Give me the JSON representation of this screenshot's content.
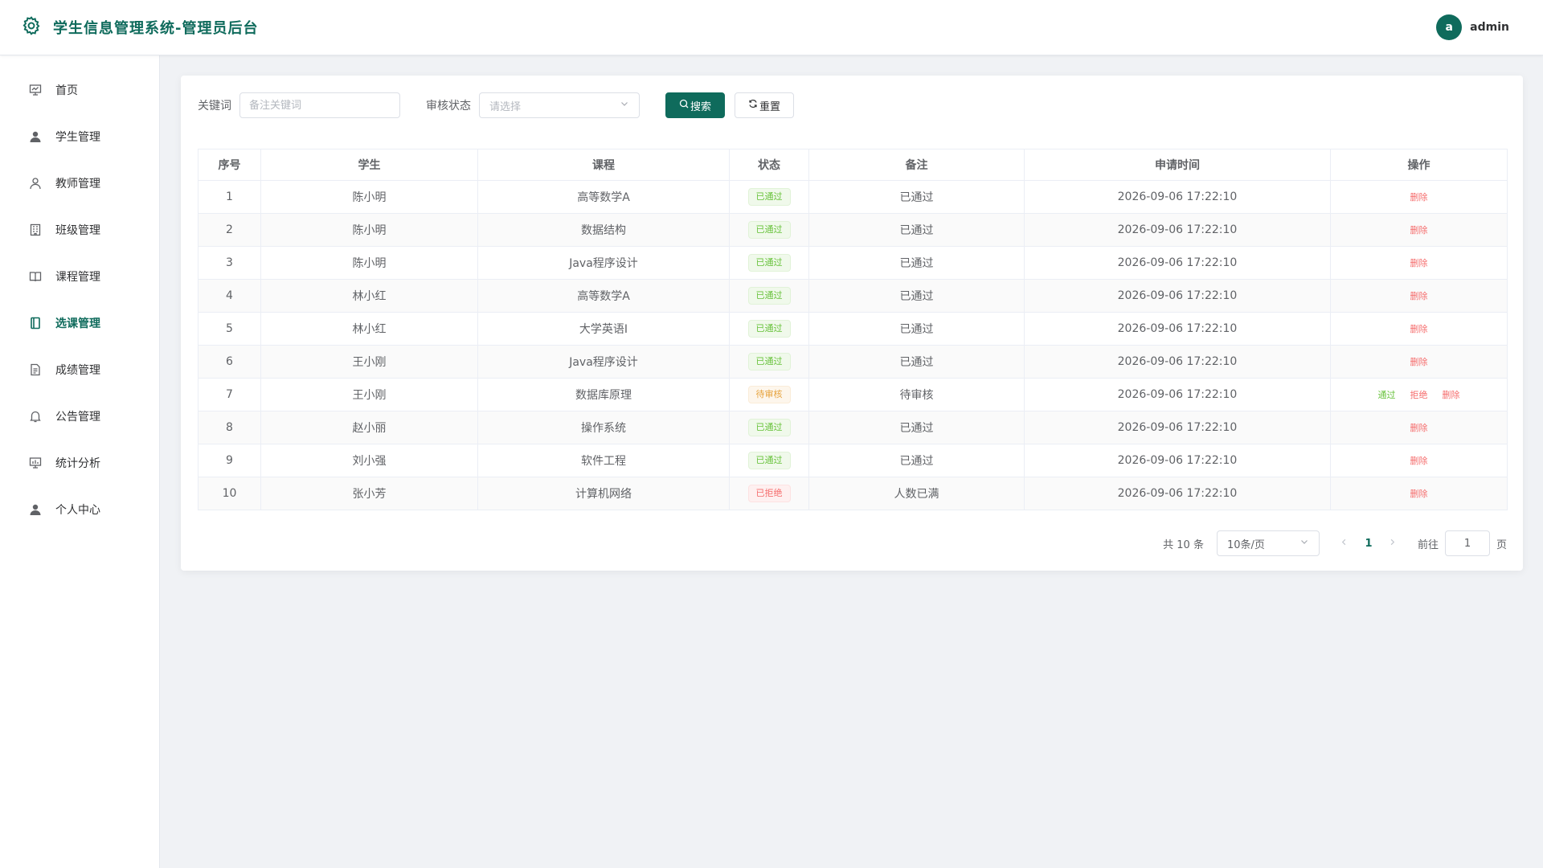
{
  "header": {
    "title": "学生信息管理系统-管理员后台",
    "avatar_letter": "a",
    "username": "admin"
  },
  "sidebar": {
    "items": [
      {
        "label": "首页",
        "icon": "dashboard-icon"
      },
      {
        "label": "学生管理",
        "icon": "user-filled-icon"
      },
      {
        "label": "教师管理",
        "icon": "user-outline-icon"
      },
      {
        "label": "班级管理",
        "icon": "building-icon"
      },
      {
        "label": "课程管理",
        "icon": "book-icon"
      },
      {
        "label": "选课管理",
        "icon": "notebook-icon",
        "active": true
      },
      {
        "label": "成绩管理",
        "icon": "document-icon"
      },
      {
        "label": "公告管理",
        "icon": "bell-icon"
      },
      {
        "label": "统计分析",
        "icon": "chart-icon"
      },
      {
        "label": "个人中心",
        "icon": "user-filled-icon"
      }
    ]
  },
  "filters": {
    "keyword_label": "关键词",
    "keyword_placeholder": "备注关键词",
    "status_label": "审核状态",
    "status_placeholder": "请选择",
    "search_label": "搜索",
    "reset_label": "重置"
  },
  "table": {
    "columns": [
      "序号",
      "学生",
      "课程",
      "状态",
      "备注",
      "申请时间",
      "操作"
    ],
    "rows": [
      {
        "no": "1",
        "student": "陈小明",
        "course": "高等数学A",
        "status": "已通过",
        "status_type": "success",
        "remark": "已通过",
        "time": "2026-09-06 17:22:10",
        "actions": [
          "删除"
        ]
      },
      {
        "no": "2",
        "student": "陈小明",
        "course": "数据结构",
        "status": "已通过",
        "status_type": "success",
        "remark": "已通过",
        "time": "2026-09-06 17:22:10",
        "actions": [
          "删除"
        ]
      },
      {
        "no": "3",
        "student": "陈小明",
        "course": "Java程序设计",
        "status": "已通过",
        "status_type": "success",
        "remark": "已通过",
        "time": "2026-09-06 17:22:10",
        "actions": [
          "删除"
        ]
      },
      {
        "no": "4",
        "student": "林小红",
        "course": "高等数学A",
        "status": "已通过",
        "status_type": "success",
        "remark": "已通过",
        "time": "2026-09-06 17:22:10",
        "actions": [
          "删除"
        ]
      },
      {
        "no": "5",
        "student": "林小红",
        "course": "大学英语I",
        "status": "已通过",
        "status_type": "success",
        "remark": "已通过",
        "time": "2026-09-06 17:22:10",
        "actions": [
          "删除"
        ]
      },
      {
        "no": "6",
        "student": "王小刚",
        "course": "Java程序设计",
        "status": "已通过",
        "status_type": "success",
        "remark": "已通过",
        "time": "2026-09-06 17:22:10",
        "actions": [
          "删除"
        ]
      },
      {
        "no": "7",
        "student": "王小刚",
        "course": "数据库原理",
        "status": "待审核",
        "status_type": "warning",
        "remark": "待审核",
        "time": "2026-09-06 17:22:10",
        "actions": [
          "通过",
          "拒绝",
          "删除"
        ]
      },
      {
        "no": "8",
        "student": "赵小丽",
        "course": "操作系统",
        "status": "已通过",
        "status_type": "success",
        "remark": "已通过",
        "time": "2026-09-06 17:22:10",
        "actions": [
          "删除"
        ]
      },
      {
        "no": "9",
        "student": "刘小强",
        "course": "软件工程",
        "status": "已通过",
        "status_type": "success",
        "remark": "已通过",
        "time": "2026-09-06 17:22:10",
        "actions": [
          "删除"
        ]
      },
      {
        "no": "10",
        "student": "张小芳",
        "course": "计算机网络",
        "status": "已拒绝",
        "status_type": "danger",
        "remark": "人数已满",
        "time": "2026-09-06 17:22:10",
        "actions": [
          "删除"
        ]
      }
    ]
  },
  "pagination": {
    "total_text": "共 10 条",
    "page_size": "10条/页",
    "current_page": "1",
    "goto_label": "前往",
    "goto_value": "1",
    "page_suffix": "页"
  },
  "colors": {
    "brand": "#0f6b5c",
    "success": "#67c23a",
    "warning": "#e6a23c",
    "danger": "#f56c6c"
  }
}
